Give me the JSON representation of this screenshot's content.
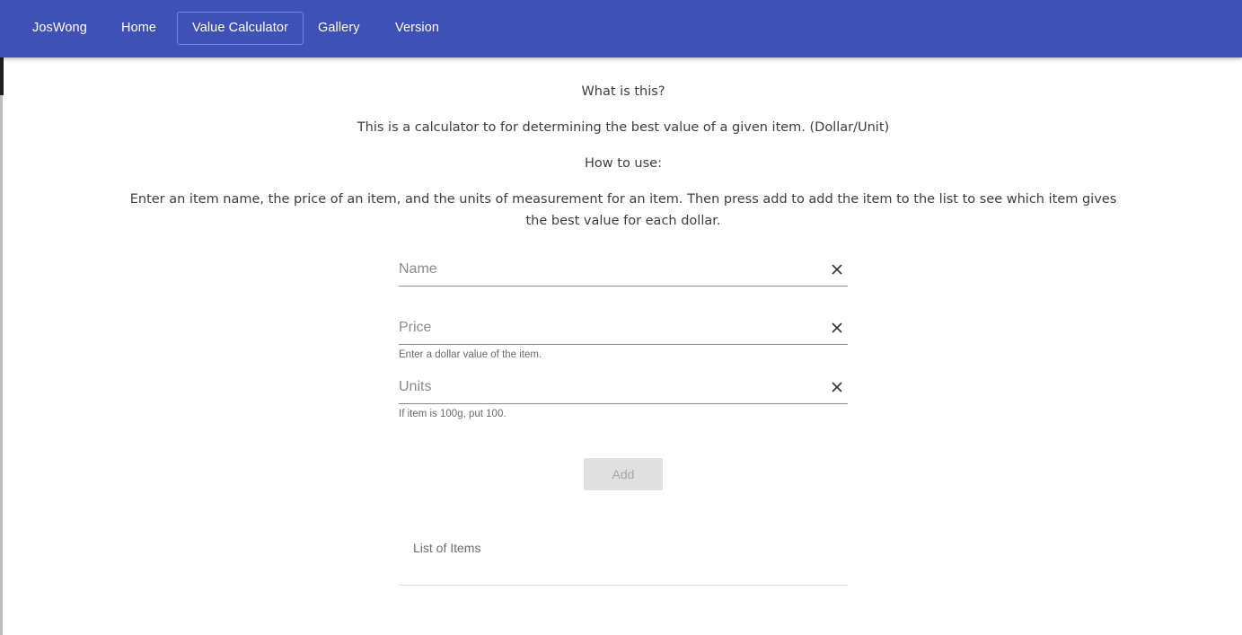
{
  "navbar": {
    "brand": "JosWong",
    "items": [
      {
        "label": "Home"
      },
      {
        "label": "Value Calculator",
        "active": true
      },
      {
        "label": "Gallery"
      },
      {
        "label": "Version"
      }
    ],
    "background_color": "#3f51b5"
  },
  "intro": {
    "what_heading": "What is this?",
    "what_text": "This is a calculator to for determining the best value of a given item. (Dollar/Unit)",
    "how_heading": "How to use:",
    "how_text": "Enter an item name, the price of an item, and the units of measurement for an item. Then press add to add the item to the list to see which item gives the best value for each dollar."
  },
  "form": {
    "name": {
      "placeholder": "Name",
      "value": ""
    },
    "price": {
      "placeholder": "Price",
      "value": "",
      "hint": "Enter a dollar value of the item."
    },
    "units": {
      "placeholder": "Units",
      "value": "",
      "hint": "If item is 100g, put 100."
    },
    "clear_icon": "close-icon",
    "add_label": "Add",
    "add_disabled": true
  },
  "list": {
    "header": "List of Items",
    "items": []
  }
}
